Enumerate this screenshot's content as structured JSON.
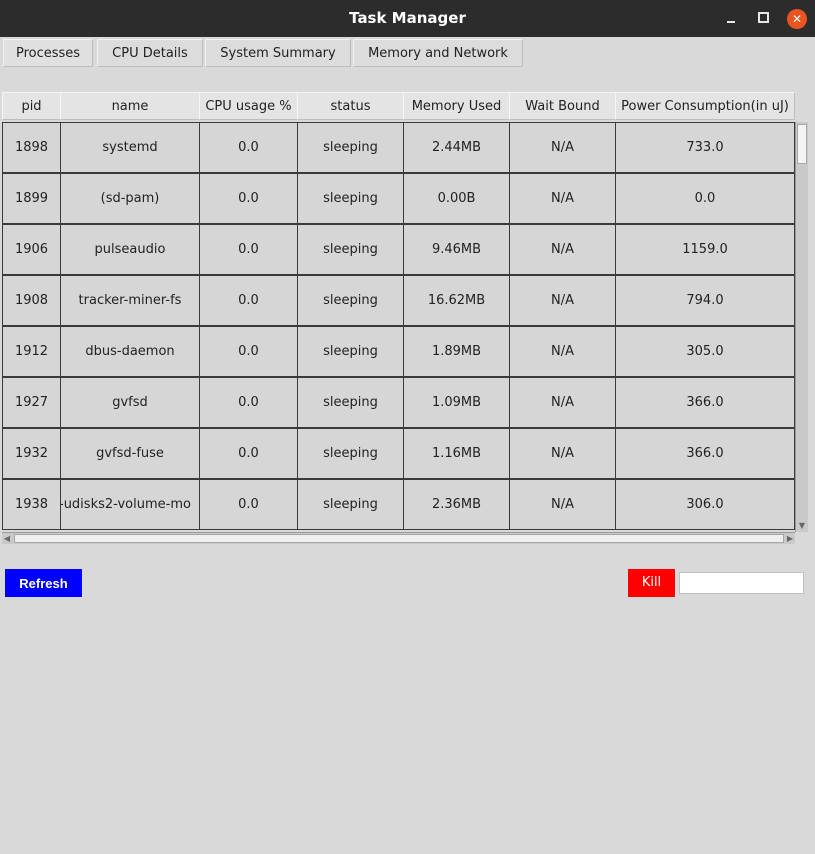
{
  "window": {
    "title": "Task Manager",
    "minimize_icon": "minimize-icon",
    "maximize_icon": "maximize-icon",
    "close_icon": "close-icon",
    "close_color": "#e95420"
  },
  "tabs": [
    {
      "label": "Processes"
    },
    {
      "label": "CPU Details"
    },
    {
      "label": "System Summary"
    },
    {
      "label": "Memory and Network"
    }
  ],
  "table": {
    "columns": [
      "pid",
      "name",
      "CPU usage %",
      "status",
      "Memory Used",
      "Wait Bound",
      "Power Consumption(in uJ)"
    ],
    "rows": [
      [
        "1898",
        "systemd",
        "0.0",
        "sleeping",
        "2.44MB",
        "N/A",
        "733.0"
      ],
      [
        "1899",
        "(sd-pam)",
        "0.0",
        "sleeping",
        "0.00B",
        "N/A",
        "0.0"
      ],
      [
        "1906",
        "pulseaudio",
        "0.0",
        "sleeping",
        "9.46MB",
        "N/A",
        "1159.0"
      ],
      [
        "1908",
        "tracker-miner-fs",
        "0.0",
        "sleeping",
        "16.62MB",
        "N/A",
        "794.0"
      ],
      [
        "1912",
        "dbus-daemon",
        "0.0",
        "sleeping",
        "1.89MB",
        "N/A",
        "305.0"
      ],
      [
        "1927",
        "gvfsd",
        "0.0",
        "sleeping",
        "1.09MB",
        "N/A",
        "366.0"
      ],
      [
        "1932",
        "gvfsd-fuse",
        "0.0",
        "sleeping",
        "1.16MB",
        "N/A",
        "366.0"
      ],
      [
        "1938",
        "-udisks2-volume-mo",
        "0.0",
        "sleeping",
        "2.36MB",
        "N/A",
        "306.0"
      ]
    ]
  },
  "controls": {
    "refresh_label": "Refresh",
    "refresh_color": "#0000ff",
    "kill_label": "Kill",
    "kill_color": "#ff0000",
    "pid_input_value": "",
    "pid_input_placeholder": ""
  }
}
